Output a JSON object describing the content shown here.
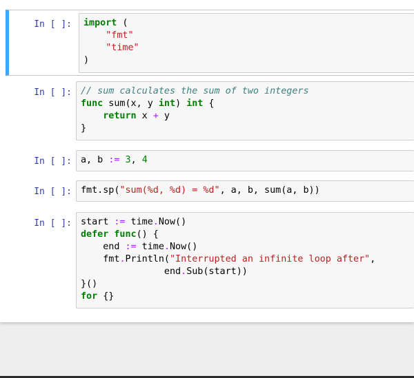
{
  "prompt": "In [ ]:",
  "cells": [
    {
      "lines": [
        [
          {
            "t": "import",
            "c": "kw"
          },
          {
            "t": " ("
          }
        ],
        [
          {
            "t": "    "
          },
          {
            "t": "\"fmt\"",
            "c": "st"
          }
        ],
        [
          {
            "t": "    "
          },
          {
            "t": "\"time\"",
            "c": "st"
          }
        ],
        [
          {
            "t": ")"
          }
        ]
      ]
    },
    {
      "lines": [
        [
          {
            "t": "// sum calculates the sum of two integers",
            "c": "cm"
          }
        ],
        [
          {
            "t": "func",
            "c": "kw"
          },
          {
            "t": " sum(x, y "
          },
          {
            "t": "int",
            "c": "kw"
          },
          {
            "t": ") "
          },
          {
            "t": "int",
            "c": "kw"
          },
          {
            "t": " {"
          }
        ],
        [
          {
            "t": "    "
          },
          {
            "t": "return",
            "c": "kw"
          },
          {
            "t": " x "
          },
          {
            "t": "+",
            "c": "op"
          },
          {
            "t": " y"
          }
        ],
        [
          {
            "t": "}"
          }
        ]
      ]
    },
    {
      "lines": [
        [
          {
            "t": "a, b "
          },
          {
            "t": ":=",
            "c": "op"
          },
          {
            "t": " "
          },
          {
            "t": "3",
            "c": "nm"
          },
          {
            "t": ", "
          },
          {
            "t": "4",
            "c": "nm"
          }
        ]
      ]
    },
    {
      "lines": [
        [
          {
            "t": "fmt.sp("
          },
          {
            "t": "\"sum(%d, %d) = %d\"",
            "c": "st"
          },
          {
            "t": ", a, b, sum(a, b))"
          }
        ]
      ]
    },
    {
      "lines": [
        [
          {
            "t": "start "
          },
          {
            "t": ":=",
            "c": "op"
          },
          {
            "t": " time"
          },
          {
            "t": ".",
            "c": "op"
          },
          {
            "t": "Now()"
          }
        ],
        [
          {
            "t": "defer",
            "c": "kw"
          },
          {
            "t": " "
          },
          {
            "t": "func",
            "c": "kw"
          },
          {
            "t": "() {"
          }
        ],
        [
          {
            "t": "    end "
          },
          {
            "t": ":=",
            "c": "op"
          },
          {
            "t": " time"
          },
          {
            "t": ".",
            "c": "op"
          },
          {
            "t": "Now()"
          }
        ],
        [
          {
            "t": "    fmt"
          },
          {
            "t": ".",
            "c": "op"
          },
          {
            "t": "Println("
          },
          {
            "t": "\"Interrupted an infinite loop after\"",
            "c": "st"
          },
          {
            "t": ","
          }
        ],
        [
          {
            "t": "               end"
          },
          {
            "t": ".",
            "c": "op"
          },
          {
            "t": "Sub(start))"
          }
        ],
        [
          {
            "t": "}()"
          }
        ],
        [
          {
            "t": "for",
            "c": "kw"
          },
          {
            "t": " {}"
          }
        ]
      ]
    }
  ]
}
